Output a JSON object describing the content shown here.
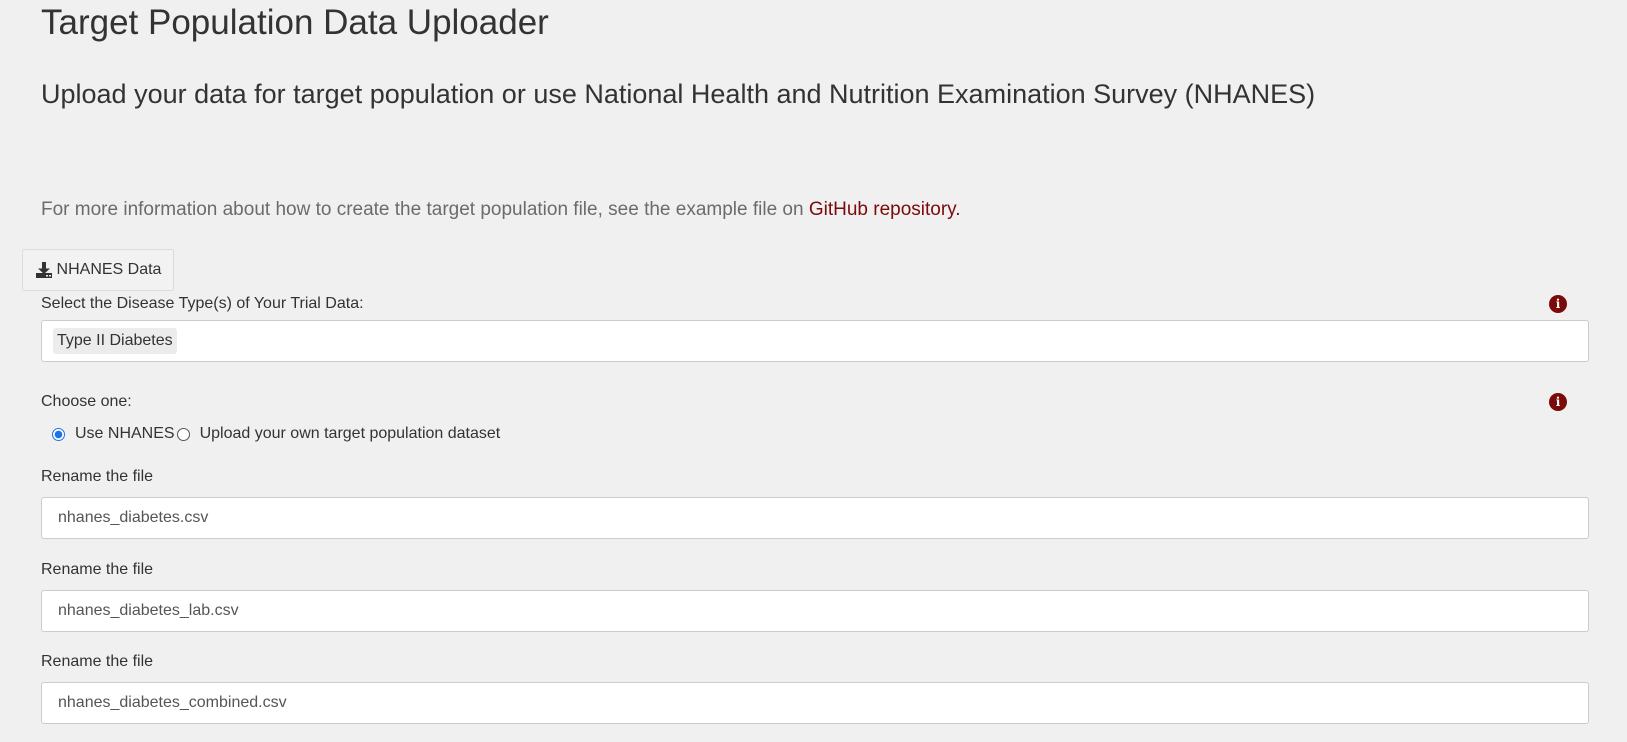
{
  "header": {
    "title": "Target Population Data Uploader",
    "subtitle": "Upload your data for target population or use National Health and Nutrition Examination Survey (NHANES)"
  },
  "info": {
    "text": "For more information about how to create the target population file, see the example file on ",
    "link_text": "GitHub repository."
  },
  "download_button": {
    "icon": "download-icon",
    "label": "NHANES Data"
  },
  "disease_select": {
    "label": "Select the Disease Type(s) of Your Trial Data:",
    "selected": [
      "Type II Diabetes"
    ],
    "help_icon": "info-icon"
  },
  "source_choice": {
    "label": "Choose one:",
    "help_icon": "info-icon",
    "options": [
      {
        "label": "Use NHANES",
        "checked": true
      },
      {
        "label": "Upload your own target population dataset",
        "checked": false
      }
    ]
  },
  "rename_fields": [
    {
      "label": "Rename the file",
      "value": "nhanes_diabetes.csv"
    },
    {
      "label": "Rename the file",
      "value": "nhanes_diabetes_lab.csv"
    },
    {
      "label": "Rename the file",
      "value": "nhanes_diabetes_combined.csv"
    }
  ],
  "colors": {
    "background": "#f0f0f0",
    "link": "#7b0a0a",
    "info_icon": "#7b0a0a",
    "radio_accent": "#1a73e8"
  }
}
